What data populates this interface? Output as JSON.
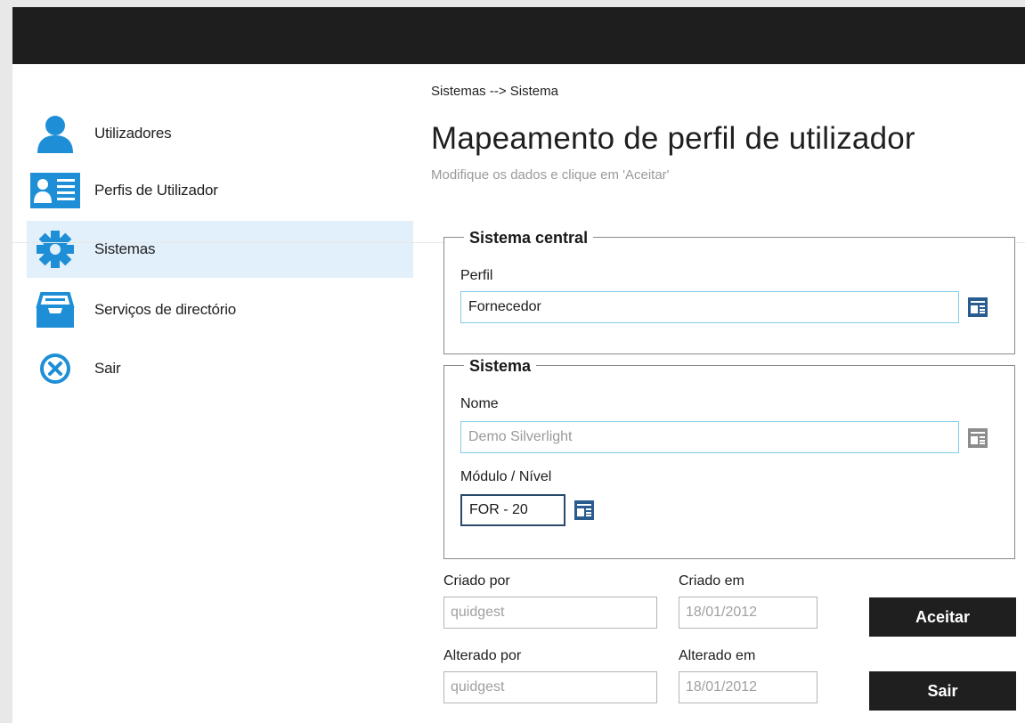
{
  "sidebar": {
    "items": [
      {
        "label": "Utilizadores",
        "icon": "user-icon"
      },
      {
        "label": "Perfis de Utilizador",
        "icon": "profile-card-icon"
      },
      {
        "label": "Sistemas",
        "icon": "gear-icon",
        "active": true
      },
      {
        "label": "Serviços de directório",
        "icon": "inbox-tray-icon"
      },
      {
        "label": "Sair",
        "icon": "close-circle-icon"
      }
    ]
  },
  "header": {
    "breadcrumb": "Sistemas --> Sistema",
    "title": "Mapeamento de perfil de utilizador",
    "subtitle": "Modifique os dados e clique em 'Aceitar'"
  },
  "sistema_central": {
    "legend": "Sistema central",
    "perfil_label": "Perfil",
    "perfil_value": "Fornecedor"
  },
  "sistema": {
    "legend": "Sistema",
    "nome_label": "Nome",
    "nome_value": "Demo Silverlight",
    "modulo_label": "Módulo / Nível",
    "modulo_value": "FOR - 20"
  },
  "audit": {
    "criado_por_label": "Criado por",
    "criado_por_value": "quidgest",
    "criado_em_label": "Criado em",
    "criado_em_value": "18/01/2012",
    "alterado_por_label": "Alterado por",
    "alterado_por_value": "quidgest",
    "alterado_em_label": "Alterado em",
    "alterado_em_value": "18/01/2012"
  },
  "actions": {
    "accept_label": "Aceitar",
    "exit_label": "Sair"
  },
  "colors": {
    "accent": "#1e8fd6",
    "active_nav_bg": "#e2f0fb",
    "topbar": "#1e1e1e",
    "button_bg": "#1f1f1f"
  }
}
